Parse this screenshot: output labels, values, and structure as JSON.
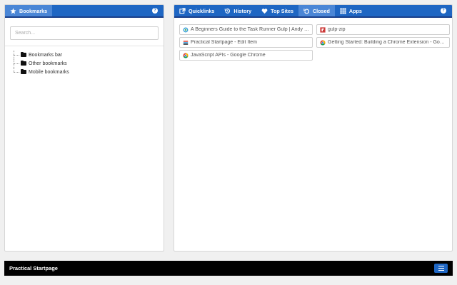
{
  "left_panel": {
    "tab_label": "Bookmarks",
    "tab_icon": "star-icon",
    "help": "?",
    "search_placeholder": "Search...",
    "tree": [
      {
        "label": "Bookmarks bar"
      },
      {
        "label": "Other bookmarks"
      },
      {
        "label": "Mobile bookmarks"
      }
    ]
  },
  "right_panel": {
    "tabs": [
      {
        "label": "Quicklinks",
        "icon": "external-link-icon"
      },
      {
        "label": "History",
        "icon": "history-icon"
      },
      {
        "label": "Top Sites",
        "icon": "heart-icon"
      },
      {
        "label": "Closed",
        "icon": "undo-icon",
        "active": true
      },
      {
        "label": "Apps",
        "icon": "grid-icon"
      }
    ],
    "help": "?",
    "links": [
      {
        "title": "A Beginners Guide to the Task Runner Gulp | Andy C...",
        "favicon": "globe-favicon"
      },
      {
        "title": "gulp-zip",
        "favicon": "npm-favicon"
      },
      {
        "title": "Practical Startpage - Edit Item",
        "favicon": "startpage-favicon"
      },
      {
        "title": "Getting Started: Building a Chrome Extension - Goog...",
        "favicon": "chrome-favicon"
      },
      {
        "title": "JavaScript APIs - Google Chrome",
        "favicon": "chrome-favicon"
      }
    ]
  },
  "footer": {
    "title": "Practical Startpage",
    "menu_icon": "hamburger-icon"
  },
  "colors": {
    "nav_blue": "#1e66c3",
    "active_tab": "#4a86d6",
    "footer_bg": "#000000"
  }
}
